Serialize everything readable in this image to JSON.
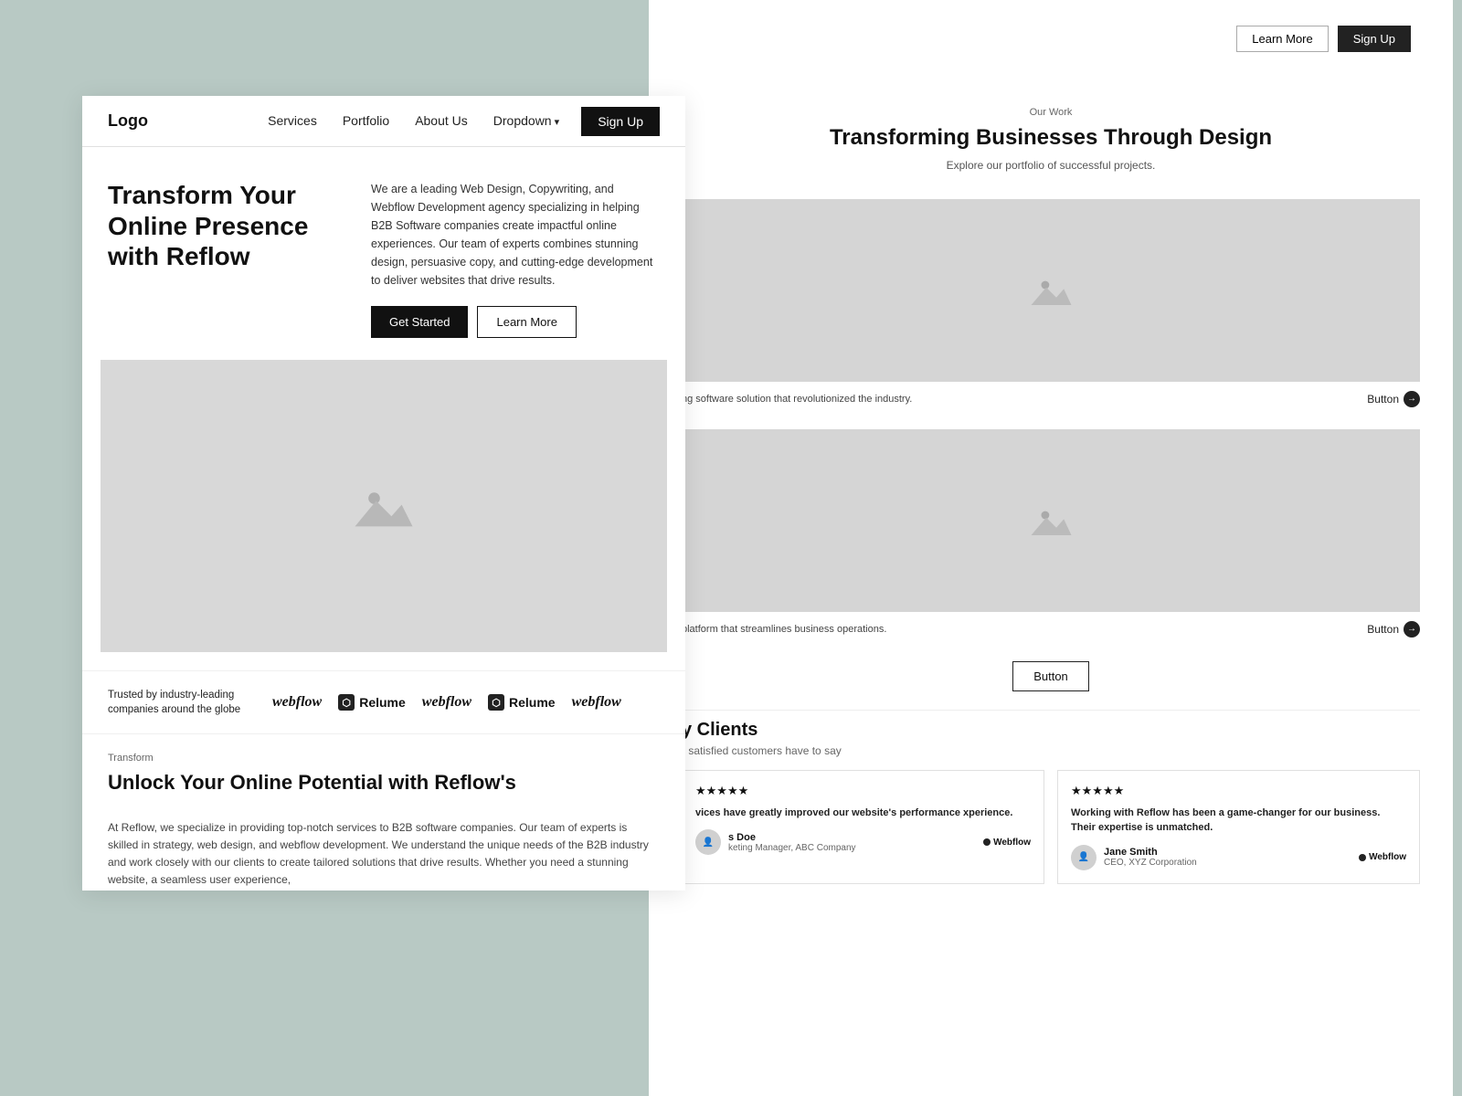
{
  "bg_page": {
    "topnav": {
      "learn_more": "Learn More",
      "signup": "Sign Up"
    },
    "our_work": {
      "label": "Our Work",
      "title": "Transforming Businesses Through Design",
      "description": "Explore our portfolio of successful projects."
    },
    "portfolio_items": [
      {
        "caption": "ng software solution that revolutionized the industry.",
        "button_label": "Button"
      },
      {
        "caption": "platform that streamlines business operations.",
        "button_label": "Button"
      }
    ],
    "center_button": "Button",
    "clients": {
      "title": "y Clients",
      "subtitle": "r satisfied customers have to say"
    },
    "testimonials": [
      {
        "stars": "★★★★★",
        "quote": "vices have greatly improved our website's performance xperience.",
        "author_name": "s Doe",
        "author_role": "keting Manager, ABC Company",
        "logo": "Webflow"
      },
      {
        "stars": "★★★★★",
        "quote": "Working with Reflow has been a game-changer for our business. Their expertise is unmatched.",
        "author_name": "Jane Smith",
        "author_role": "CEO, XYZ Corporation",
        "logo": "Webflow"
      }
    ]
  },
  "fg_page": {
    "nav": {
      "logo": "Logo",
      "links": [
        {
          "label": "Services"
        },
        {
          "label": "Portfolio"
        },
        {
          "label": "About Us"
        },
        {
          "label": "Dropdown",
          "has_dropdown": true
        }
      ],
      "signup_label": "Sign Up"
    },
    "hero": {
      "title": "Transform Your Online Presence with Reflow",
      "description": "We are a leading Web Design, Copywriting, and Webflow Development agency specializing in helping B2B Software companies create impactful online experiences. Our team of experts combines stunning design, persuasive copy, and cutting-edge development to deliver websites that drive results.",
      "btn_primary": "Get Started",
      "btn_secondary": "Learn More"
    },
    "trusted": {
      "text": "Trusted by industry-leading companies around the globe",
      "logos": [
        "webflow",
        "Relume",
        "webflow",
        "Relume",
        "webflow"
      ]
    },
    "transform": {
      "label": "Transform",
      "title": "Unlock Your Online Potential with Reflow's"
    },
    "services_desc": "At Reflow, we specialize in providing top-notch services to B2B software companies. Our team of experts is skilled in strategy, web design, and webflow development. We understand the unique needs of the B2B industry and work closely with our clients to create tailored solutions that drive results. Whether you need a stunning website, a seamless user experience,"
  }
}
